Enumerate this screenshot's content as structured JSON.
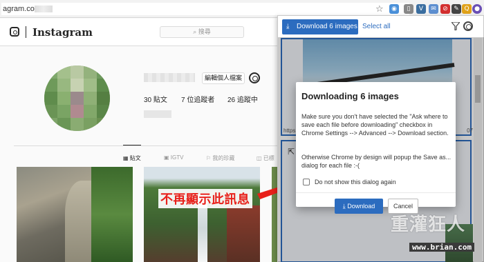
{
  "browser": {
    "url": "agram.co",
    "extensions": [
      {
        "name": "drive-icon",
        "color": "#4a90d9",
        "glyph": "◉"
      },
      {
        "name": "page-icon",
        "color": "#888888",
        "glyph": "▯"
      },
      {
        "name": "vk-icon",
        "color": "#3b6ea0",
        "glyph": "V"
      },
      {
        "name": "mail-icon",
        "color": "#5d8fd0",
        "glyph": "✉"
      },
      {
        "name": "block-icon",
        "color": "#d32f2f",
        "glyph": "⊘"
      },
      {
        "name": "tags-icon",
        "color": "#444444",
        "glyph": "✎"
      },
      {
        "name": "q-icon",
        "color": "#e0a21a",
        "glyph": "Q"
      },
      {
        "name": "download-icon",
        "color": "#5a5a5a",
        "glyph": "⬇"
      },
      {
        "name": "profile-icon",
        "color": "#6a4fb5",
        "glyph": "●"
      }
    ]
  },
  "instagram": {
    "brand": "Instagram",
    "search_placeholder": "搜尋",
    "edit_profile": "編輯個人檔案",
    "stats": {
      "posts": "30 貼文",
      "followers": "7 位追蹤者",
      "following": "26 追蹤中"
    },
    "tabs": {
      "posts": "貼文",
      "igtv": "IGTV",
      "saved": "我的珍藏",
      "tagged": "已標"
    }
  },
  "annotation": {
    "text": "不再顯示此訊息"
  },
  "extension": {
    "download_button": "Download 6 images",
    "select_all": "Select all",
    "card1_url_left": "https",
    "card1_url_right": "07"
  },
  "modal": {
    "title": "Downloading 6 images",
    "paragraph1": "Make sure you don't have selected the \"Ask where to save each file before downloading\" checkbox in Chrome Settings --> Advanced --> Download section.",
    "paragraph2": "Otherwise Chrome by design will popup the Save as... dialog for each file :-(",
    "checkbox_label": "Do not show this dialog again",
    "download_button": "Download",
    "cancel_button": "Cancel"
  },
  "watermark": {
    "main": "重灌狂人",
    "sub": "www.brian.com"
  },
  "colors": {
    "accent": "#2c6cbf",
    "annotation_red": "#e8201a"
  }
}
